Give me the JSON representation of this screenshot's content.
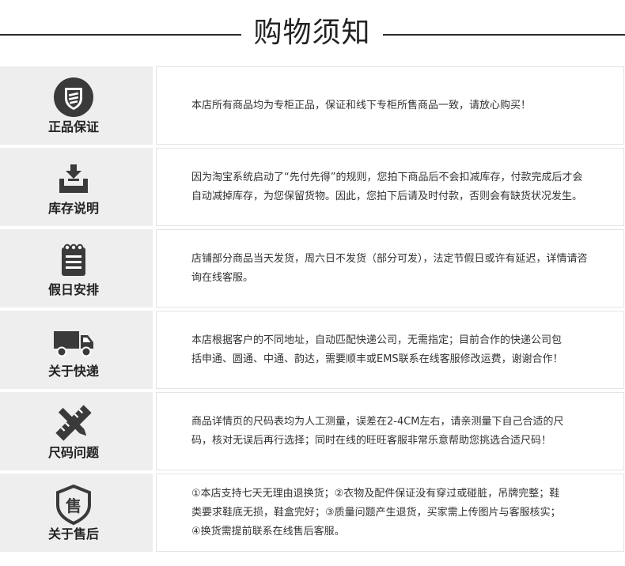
{
  "title": "购物须知",
  "colors": {
    "icon": "#3a3a3a",
    "side_bg": "#eeeeee",
    "border": "#e4e4e4"
  },
  "sections": [
    {
      "icon": "shield-icon",
      "label": "正品保证",
      "lines": [
        "本店所有商品均为专柜正品，保证和线下专柜所售商品一致，请放心购买！"
      ]
    },
    {
      "icon": "inbox-download-icon",
      "label": "库存说明",
      "lines": [
        "因为淘宝系统启动了“先付先得”的规则，您拍下商品后不会扣减库存，付款完成后才会",
        "自动减掉库存，为您保留货物。因此，您拍下后请及时付款，否则会有缺货状况发生。"
      ]
    },
    {
      "icon": "notepad-icon",
      "label": "假日安排",
      "lines": [
        "店铺部分商品当天发货，周六日不发货（部分可发），法定节假日或许有延迟，详情请咨",
        "询在线客服。"
      ]
    },
    {
      "icon": "truck-icon",
      "label": "关于快递",
      "lines": [
        "本店根据客户的不同地址，自动匹配快递公司，无需指定；目前合作的快递公司包",
        "括申通、圆通、中通、韵达，需要顺丰或EMS联系在线客服修改运费，谢谢合作！"
      ]
    },
    {
      "icon": "ruler-pencil-icon",
      "label": "尺码问题",
      "lines": [
        "商品详情页的尺码表均为人工测量，误差在2-4CM左右，请亲测量下自己合适的尺",
        "码，核对无误后再行选择；同时在线的旺旺客服非常乐意帮助您挑选合适尺码！"
      ]
    },
    {
      "icon": "after-sale-shield-icon",
      "label": "关于售后",
      "icon_glyph": "售",
      "lines": [
        "①本店支持七天无理由退换货；②衣物及配件保证没有穿过或碰脏，吊牌完整；鞋",
        "类要求鞋底无损，鞋盒完好；③质量问题产生退货，买家需上传图片与客服核实；",
        "④换货需提前联系在线售后客服。"
      ]
    }
  ]
}
